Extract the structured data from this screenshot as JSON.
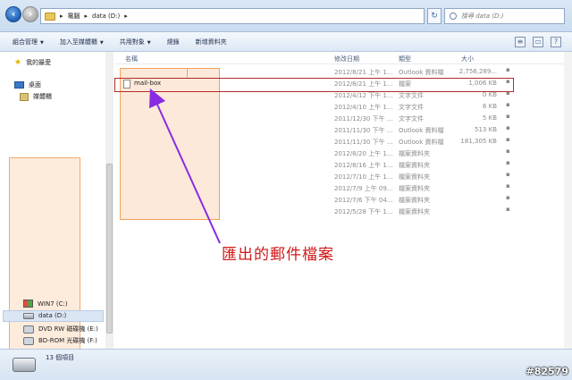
{
  "address": {
    "crumbs": [
      "電腦",
      "data (D:)"
    ],
    "search_placeholder": "搜尋 data (D:)"
  },
  "toolbar": {
    "organize": "組合管理",
    "add_to_library": "加入至媒體櫃",
    "share_with": "共用對象",
    "burn": "燒錄",
    "new_folder": "新增資料夾"
  },
  "navigation": {
    "favorites": "我的最愛",
    "desktop": "桌面",
    "libraries": "媒體櫃",
    "drives": [
      {
        "label": "WIN7 (C:)",
        "icon": "windows-drive-icon"
      },
      {
        "label": "data (D:)",
        "icon": "drive-icon",
        "selected": true
      },
      {
        "label": "DVD RW 磁碟機 (E:)",
        "icon": "optical-drive-icon"
      },
      {
        "label": "BD-ROM 光碟機 (F:)",
        "icon": "optical-drive-icon"
      }
    ]
  },
  "columns": {
    "name": "名稱",
    "date": "修改日期",
    "type": "類型",
    "size": "大小"
  },
  "files": [
    {
      "name": "",
      "date": "2012/8/21 上午 1...",
      "type": "Outlook 資料檔",
      "size": "2,756,289..."
    },
    {
      "name": "mail-box",
      "date": "2012/8/21 上午 1...",
      "type": "檔案",
      "size": "1,006 KB",
      "selected": true
    },
    {
      "name": "",
      "date": "2012/4/12 下午 1...",
      "type": "文字文件",
      "size": "0 KB"
    },
    {
      "name": "",
      "date": "2012/4/10 上午 1...",
      "type": "文字文件",
      "size": "6 KB"
    },
    {
      "name": "",
      "date": "2011/12/30 下午 ...",
      "type": "文字文件",
      "size": "5 KB"
    },
    {
      "name": "",
      "date": "2011/11/30 下午 ...",
      "type": "Outlook 資料檔",
      "size": "513 KB"
    },
    {
      "name": "",
      "date": "2011/11/30 下午 ...",
      "type": "Outlook 資料檔",
      "size": "181,305 KB"
    },
    {
      "name": "",
      "date": "2012/8/20 上午 1...",
      "type": "檔案資料夾",
      "size": ""
    },
    {
      "name": "",
      "date": "2012/8/16 上午 1...",
      "type": "檔案資料夾",
      "size": ""
    },
    {
      "name": "",
      "date": "2012/7/10 上午 1...",
      "type": "檔案資料夾",
      "size": ""
    },
    {
      "name": "",
      "date": "2012/7/9 上午 09...",
      "type": "檔案資料夾",
      "size": ""
    },
    {
      "name": "",
      "date": "2012/7/6 下午 04...",
      "type": "檔案資料夾",
      "size": ""
    },
    {
      "name": "",
      "date": "2012/5/28 下午 1...",
      "type": "檔案資料夾",
      "size": ""
    }
  ],
  "annotation": "匯出的郵件檔案",
  "status": {
    "item_count": "13 個項目"
  },
  "watermark": "#82579",
  "colors": {
    "annotation_red": "#d01818",
    "arrow_purple": "#8a2be2",
    "highlight_fill": "#fde9d9",
    "highlight_border": "#f2a25a",
    "selection_outline": "#b02b2b"
  }
}
